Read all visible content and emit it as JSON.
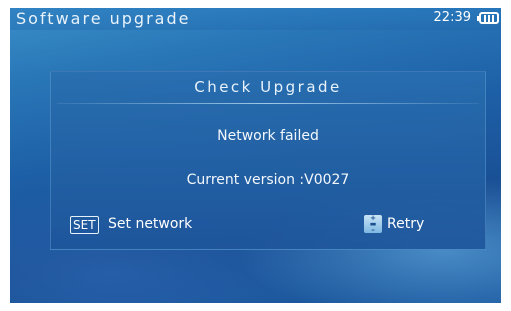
{
  "statusbar": {
    "title": "Software upgrade",
    "clock": "22:39",
    "battery_icon": "battery-icon"
  },
  "dialog": {
    "title": "Check Upgrade",
    "status": "Network failed",
    "version": "Current version :V0027",
    "set_key": "SET",
    "set_label": "Set network",
    "retry_icon": "adjust-plus-minus-icon",
    "retry_label": "Retry"
  }
}
